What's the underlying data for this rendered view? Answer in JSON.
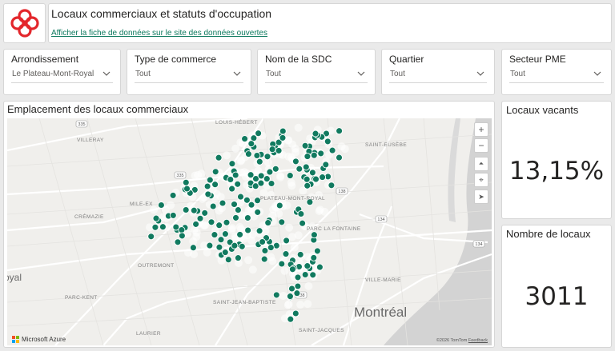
{
  "header": {
    "title": "Locaux commerciaux et statuts d'occupation",
    "link_text": "Afficher la fiche de données sur le site des données ouvertes"
  },
  "slicers": [
    {
      "label": "Arrondissement",
      "value": "Le Plateau-Mont-Royal"
    },
    {
      "label": "Type de commerce",
      "value": "Tout"
    },
    {
      "label": "Nom de la SDC",
      "value": "Tout"
    },
    {
      "label": "Quartier",
      "value": "Tout"
    },
    {
      "label": "Secteur PME",
      "value": "Tout"
    }
  ],
  "map": {
    "title": "Emplacement des locaux commerciaux",
    "labels": {
      "louis_hebert": "LOUIS-HÉBERT",
      "villeray": "VILLERAY",
      "saint_eusebe": "SAINT-EUSÈBE",
      "mile_ex": "MILE-EX",
      "plateau": "PLATEAU-MONT-ROYAL",
      "parc_la_fontaine": "PARC LA FONTAINE",
      "cremazie": "CRÉMAZIE",
      "outremont": "OUTREMONT",
      "ville_marie": "VILLE-MARIE",
      "parc_kent": "PARC-KENT",
      "saint_jean_baptiste": "SAINT-JEAN-BAPTISTE",
      "laurier": "LAURIER",
      "saint_jacques": "SAINT-JACQUES",
      "royal": "oyal",
      "montreal": "Montréal"
    },
    "shields": [
      "335",
      "335",
      "138",
      "134",
      "134",
      "138"
    ],
    "attribution": "Microsoft Azure",
    "copyright": "©2026 TomTom",
    "feedback": "Feedback",
    "marker_color": "#117a5f",
    "controls": [
      "+",
      "−",
      "⏶",
      "⌖",
      "➤"
    ]
  },
  "kpis": {
    "vacant_title": "Locaux vacants",
    "vacant_value": "13,15%",
    "count_title": "Nombre de locaux",
    "count_value": "3011"
  },
  "colors": {
    "accent": "#0e7a5f",
    "logo_red": "#e3262b"
  }
}
